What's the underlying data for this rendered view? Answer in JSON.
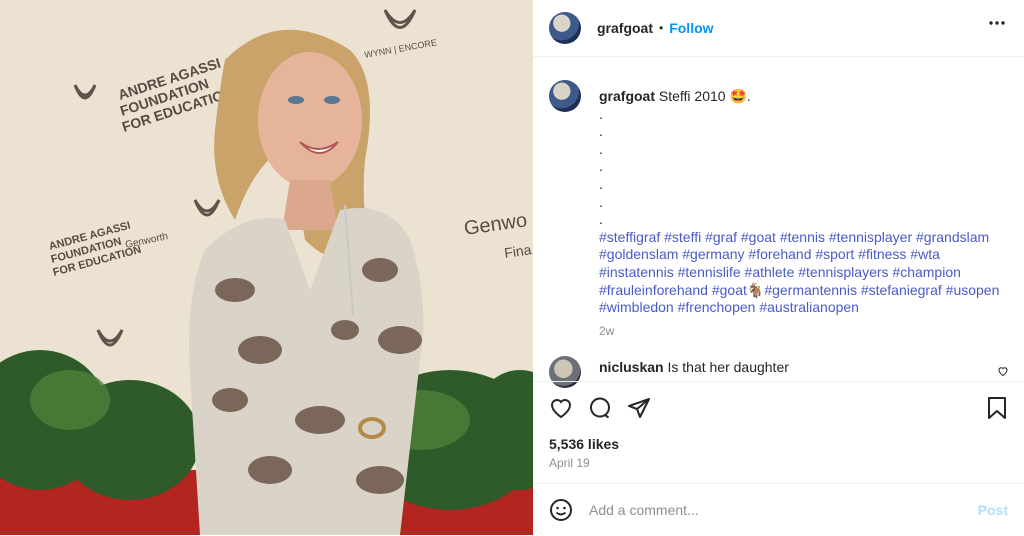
{
  "post": {
    "image_alt_subject": "woman-smiling-at-event"
  },
  "header": {
    "username": "grafgoat",
    "separator": "•",
    "follow_label": "Follow",
    "more_label": "•••"
  },
  "caption": {
    "username": "grafgoat",
    "text": "Steffi 2010",
    "emoji": "🤩",
    "trailing": ".",
    "dots": [
      ".",
      ".",
      ".",
      ".",
      ".",
      ".",
      "."
    ],
    "hashtags": "#steffigraf #steffi #graf #goat #tennis #tennisplayer #grandslam #goldenslam #germany #forehand #sport #fitness #wta #instatennis #tennislife #athlete #tennisplayers #champion #frauleinforehand #goat🐐#germantennis #stefaniegraf #usopen #wimbledon #frenchopen #australianopen",
    "time": "2w"
  },
  "comment": {
    "username": "nicluskan",
    "text": "Is that her daughter"
  },
  "engagement": {
    "likes": "5,536 likes",
    "date": "April 19"
  },
  "add_comment": {
    "placeholder": "Add a comment...",
    "post_label": "Post"
  },
  "colors": {
    "link": "#0095f6",
    "hashtag": "#4a5bc7",
    "muted": "#8e8e8e"
  },
  "icons": [
    "heart-icon",
    "comment-icon",
    "share-icon",
    "bookmark-icon",
    "emoji-icon",
    "small-heart-icon"
  ]
}
